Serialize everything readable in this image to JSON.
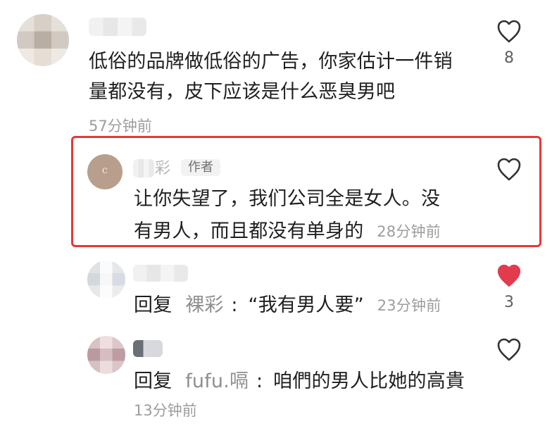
{
  "comments": [
    {
      "content_line1": "低俗的品牌做低俗的广告，你家估计一件销",
      "content_line2": "量都没有，皮下应该是什么恶臭男吧",
      "time": "57分钟前",
      "likes": "8"
    }
  ],
  "author_reply": {
    "username_visible": "彩",
    "author_tag": "作者",
    "content_line1": "让你失望了，我们公司全是女人。没",
    "content_line2": "有男人，而且都没有单身的",
    "time": "28分钟前",
    "logo_text": "C"
  },
  "reply2": {
    "prefix": "回复",
    "target": "裸彩",
    "content": "“我有男人要”",
    "time": "23分钟前",
    "likes": "3"
  },
  "reply3": {
    "prefix": "回复",
    "target": "fufu.嗝",
    "content": "咱們的男人比她的高貴",
    "time": "13分钟前"
  },
  "icons": {
    "heart_outline": "heart-outline-icon",
    "heart_filled": "heart-filled-icon"
  },
  "colors": {
    "like_red": "#e23b4d",
    "highlight_red": "#e53935"
  }
}
